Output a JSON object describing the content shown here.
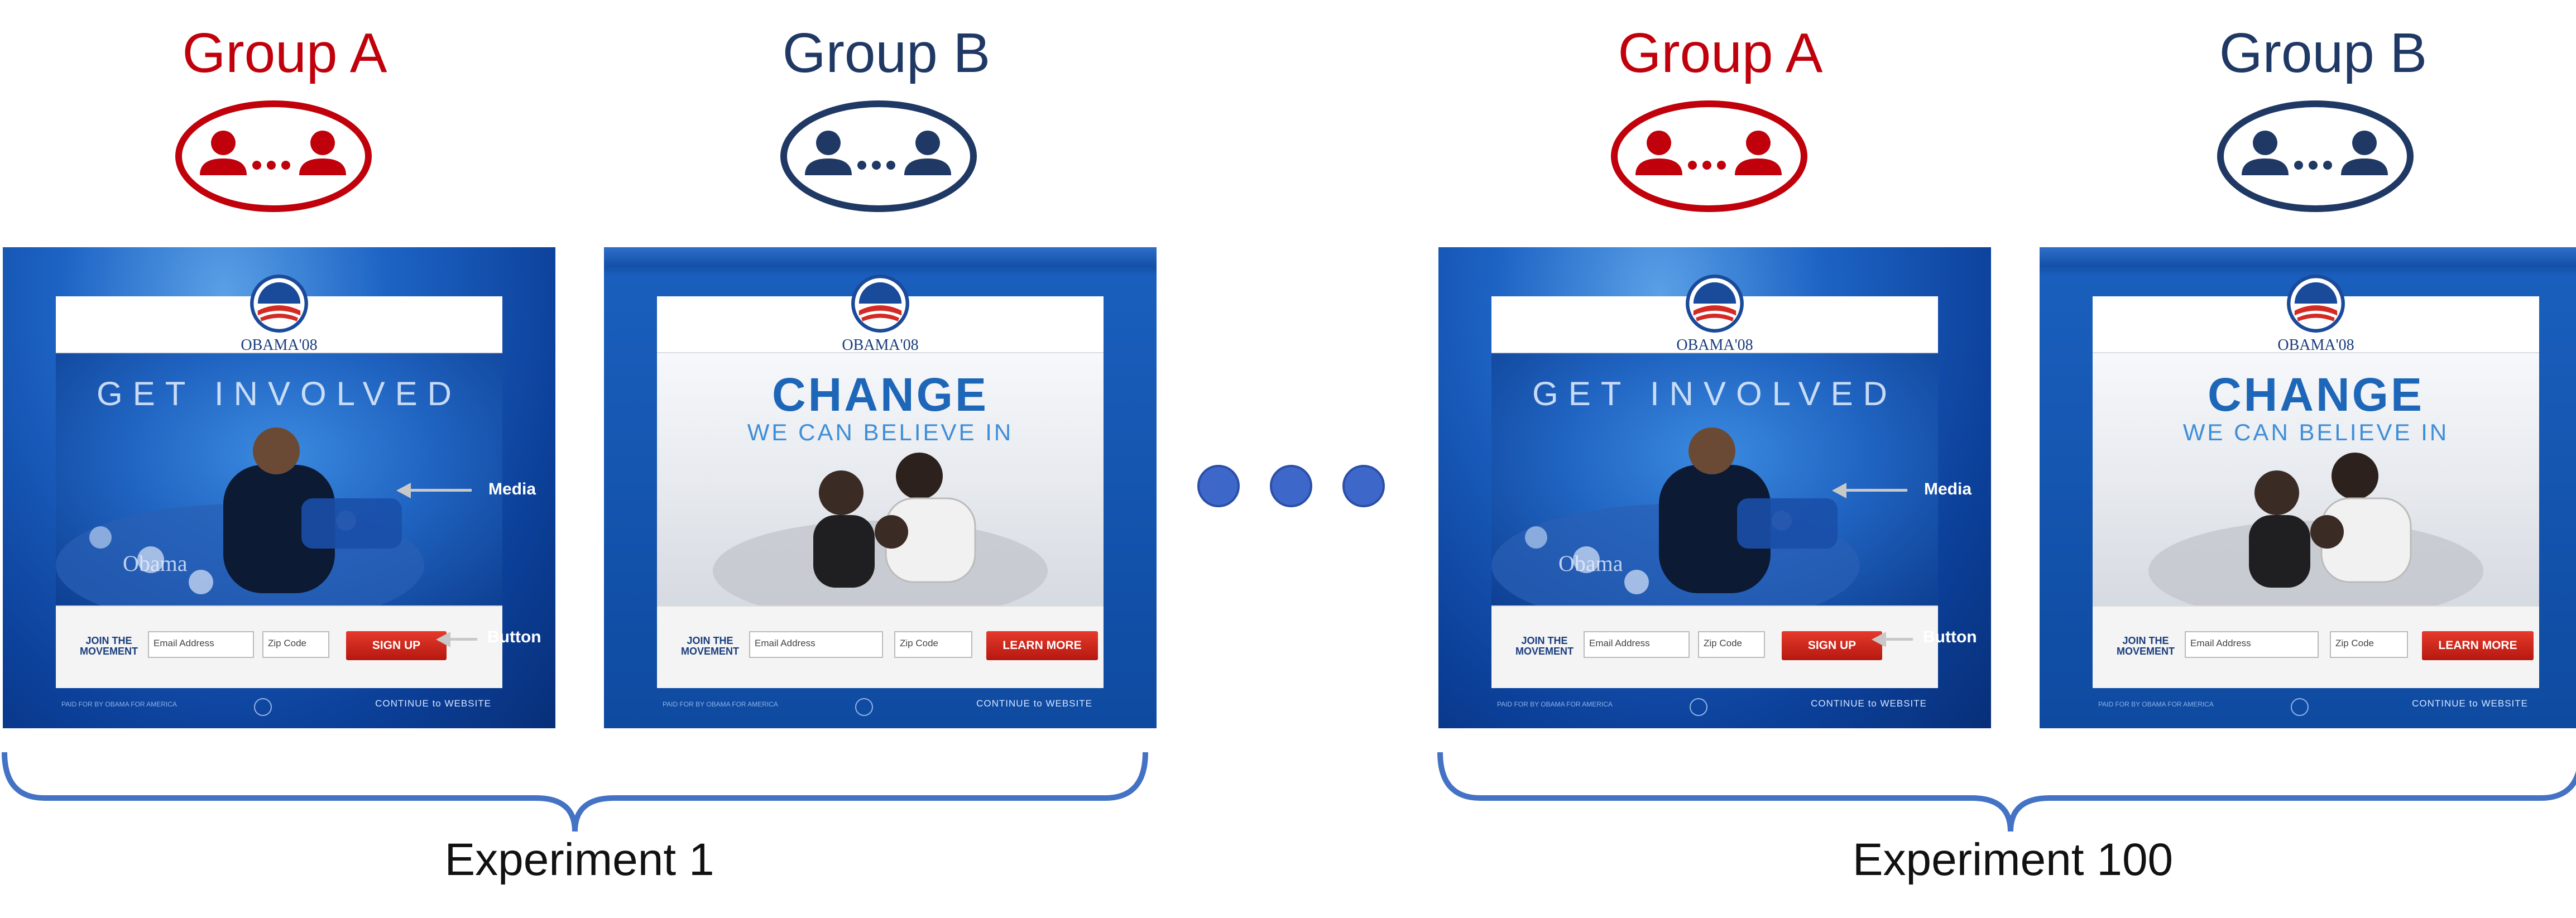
{
  "experiment_1": {
    "group_a": {
      "label": "Group A",
      "color": "#c0000b"
    },
    "group_b": {
      "label": "Group B",
      "color": "#1f3864"
    },
    "label": "Experiment 1"
  },
  "experiment_100": {
    "group_a": {
      "label": "Group A",
      "color": "#c0000b"
    },
    "group_b": {
      "label": "Group B",
      "color": "#1f3864"
    },
    "label": "Experiment 100"
  },
  "variant_a": {
    "brand": "OBAMA'08",
    "hero_text": "GET INVOLVED",
    "join_text": "JOIN THE MOVEMENT",
    "email_placeholder": "Email Address",
    "zip_placeholder": "Zip Code",
    "button_label": "SIGN UP",
    "footer_left": "PAID FOR BY OBAMA FOR AMERICA",
    "footer_right": "CONTINUE to WEBSITE",
    "media_annotation": "Media",
    "button_annotation": "Button"
  },
  "variant_b": {
    "brand": "OBAMA'08",
    "hero_line1": "CHANGE",
    "hero_line2": "WE CAN BELIEVE IN",
    "join_text": "JOIN THE MOVEMENT",
    "email_placeholder": "Email Address",
    "zip_placeholder": "Zip Code",
    "button_label": "LEARN MORE",
    "footer_left": "PAID FOR BY OBAMA FOR AMERICA",
    "footer_right": "CONTINUE to WEBSITE"
  },
  "colors": {
    "brace": "#4472c4",
    "dots": "#3d67c9"
  }
}
